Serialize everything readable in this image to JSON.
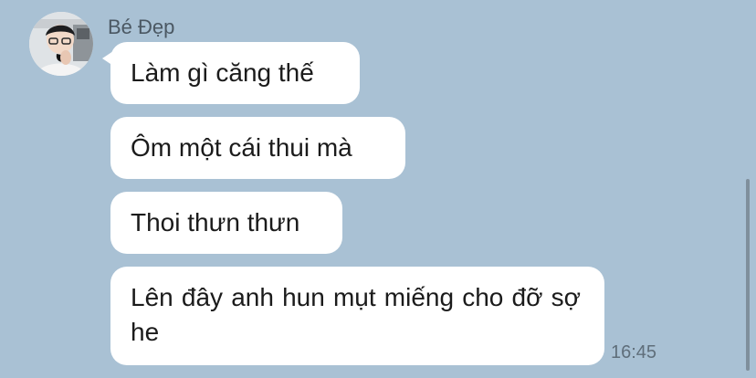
{
  "chat": {
    "sender_name": "Bé Đẹp",
    "messages": [
      {
        "text": "Làm gì căng thế"
      },
      {
        "text": "Ôm một cái thui mà"
      },
      {
        "text": "Thoi thưn thưn"
      },
      {
        "text": "Lên đây anh hun mụt miếng cho đỡ sợ he"
      }
    ],
    "last_time": "16:45"
  },
  "colors": {
    "background": "#a9c1d4",
    "bubble": "#ffffff",
    "text": "#1b1b1b",
    "name": "#4b5863",
    "timestamp": "#5f6e7a"
  },
  "icons": {
    "avatar": "contact-avatar-photo"
  }
}
